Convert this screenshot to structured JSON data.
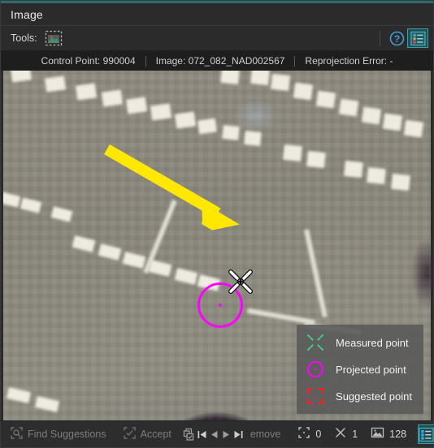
{
  "window": {
    "title": "Image",
    "accent_color": "#2d6b73"
  },
  "tools_bar": {
    "label": "Tools:",
    "image_tool_icon": "image-selection-tool-icon",
    "help_icon": "help-question-icon",
    "legend_icon": "legend-list-icon"
  },
  "status": {
    "control_point": "Control Point: 990004",
    "image": "Image: 072_082_NAD002567",
    "reprojection_error": "Reprojection Error: -"
  },
  "markers": {
    "projected_point_color": "#ff00ff",
    "measured_point_color": "#3ddb8e",
    "suggested_point_color": "#ff2020",
    "arrow_color": "#ffe800",
    "cursor_icon": "measure-x-cursor-icon"
  },
  "legend": {
    "items": [
      {
        "label": "Measured point",
        "glyph": "measured-point-icon"
      },
      {
        "label": "Projected point",
        "glyph": "projected-point-icon"
      },
      {
        "label": "Suggested point",
        "glyph": "suggested-point-icon"
      }
    ]
  },
  "bottom_bar": {
    "find_suggestions": "Find Suggestions",
    "accept": "Accept",
    "remove": "emove",
    "nav": {
      "first": "first-record-icon",
      "previous": "previous-record-icon",
      "next": "next-record-icon",
      "last": "last-record-icon"
    },
    "counts": {
      "suggested": "0",
      "measured": "1",
      "images": "128"
    },
    "legend_toggle_icon": "legend-toggle-icon"
  }
}
